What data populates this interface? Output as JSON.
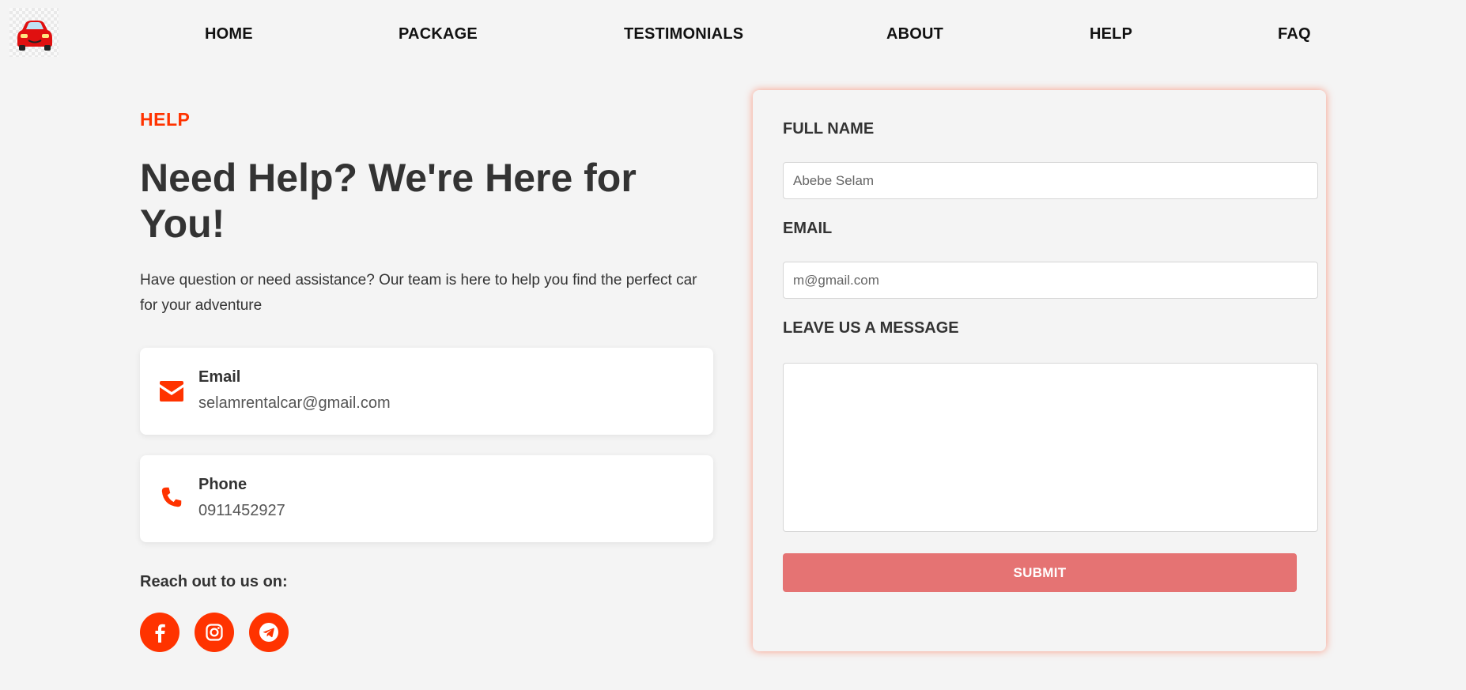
{
  "colors": {
    "accent": "#ff3300",
    "submit_bg": "#e57373",
    "text_dark": "#333333",
    "text_muted": "#555555",
    "background": "#f4f4f4"
  },
  "nav": {
    "logo_icon": "red-car-icon",
    "links": [
      {
        "label": "HOME"
      },
      {
        "label": "PACKAGE"
      },
      {
        "label": "TESTIMONIALS"
      },
      {
        "label": "ABOUT"
      },
      {
        "label": "HELP"
      },
      {
        "label": "FAQ"
      }
    ]
  },
  "help": {
    "tag": "HELP",
    "heading": "Need Help? We're Here for You!",
    "intro": "Have question or need assistance? Our team is here to help you find the perfect car for your adventure",
    "contacts": [
      {
        "icon": "envelope-icon",
        "title": "Email",
        "value": "selamrentalcar@gmail.com"
      },
      {
        "icon": "phone-icon",
        "title": "Phone",
        "value": "0911452927"
      }
    ],
    "reach_label": "Reach out to us on:",
    "socials": [
      {
        "icon": "facebook-icon"
      },
      {
        "icon": "instagram-icon"
      },
      {
        "icon": "telegram-icon"
      }
    ]
  },
  "form": {
    "full_name_label": "FULL NAME",
    "full_name_placeholder": "Abebe Selam",
    "email_label": "EMAIL",
    "email_placeholder": "m@gmail.com",
    "message_label": "LEAVE US A MESSAGE",
    "message_value": "",
    "submit_label": "SUBMIT"
  }
}
